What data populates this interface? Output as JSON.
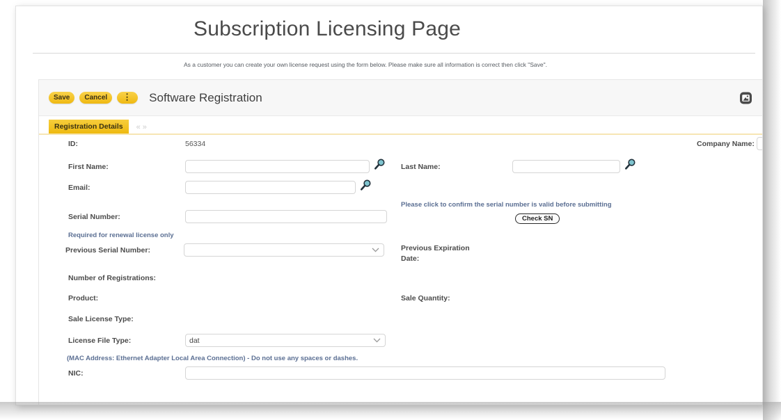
{
  "page": {
    "title": "Subscription Licensing Page",
    "subtitle": "As a customer you can create your own license request using the form below. Please make sure all information is correct then click \"Save\"."
  },
  "colors": {
    "accent_gold": "#f3c41c",
    "tab_underline": "#f7e6b4",
    "note_blue": "#5b6f93",
    "label_gray": "#4b4b4b",
    "toolbar_bg": "#f7f7f7"
  },
  "toolbar": {
    "save_label": "Save",
    "cancel_label": "Cancel",
    "more_label": "⋮",
    "panel_title": "Software Registration",
    "expand_icon": "expand-window-icon"
  },
  "tabs": {
    "active_label": "Registration Details",
    "nav_prev": "«",
    "nav_next": "»"
  },
  "form": {
    "id_label": "ID:",
    "id_value": "56334",
    "company_name_label": "Company Name:",
    "company_name_value": "",
    "first_name_label": "First Name:",
    "first_name_value": "",
    "last_name_label": "Last Name:",
    "last_name_value": "",
    "email_label": "Email:",
    "email_value": "",
    "serial_number_label": "Serial Number:",
    "serial_number_value": "",
    "check_sn_note": "Please click to confirm the serial number is valid before submitting",
    "check_sn_label": "Check SN",
    "renewal_note": "Required for renewal license only",
    "previous_serial_label": "Previous Serial Number:",
    "previous_serial_value": "",
    "previous_expiration_label_line1": "Previous Expiration",
    "previous_expiration_label_line2": "Date:",
    "number_of_registrations_label": "Number of Registrations:",
    "number_of_registrations_value": "",
    "product_label": "Product:",
    "product_value": "",
    "sale_quantity_label": "Sale Quantity:",
    "sale_quantity_value": "",
    "sale_license_type_label": "Sale License Type:",
    "sale_license_type_value": "",
    "license_file_type_label": "License File Type:",
    "license_file_type_value": "dat",
    "mac_note": "(MAC Address: Ethernet Adapter Local Area Connection) - Do not use any spaces or dashes.",
    "nic_label": "NIC:",
    "nic_value": ""
  }
}
